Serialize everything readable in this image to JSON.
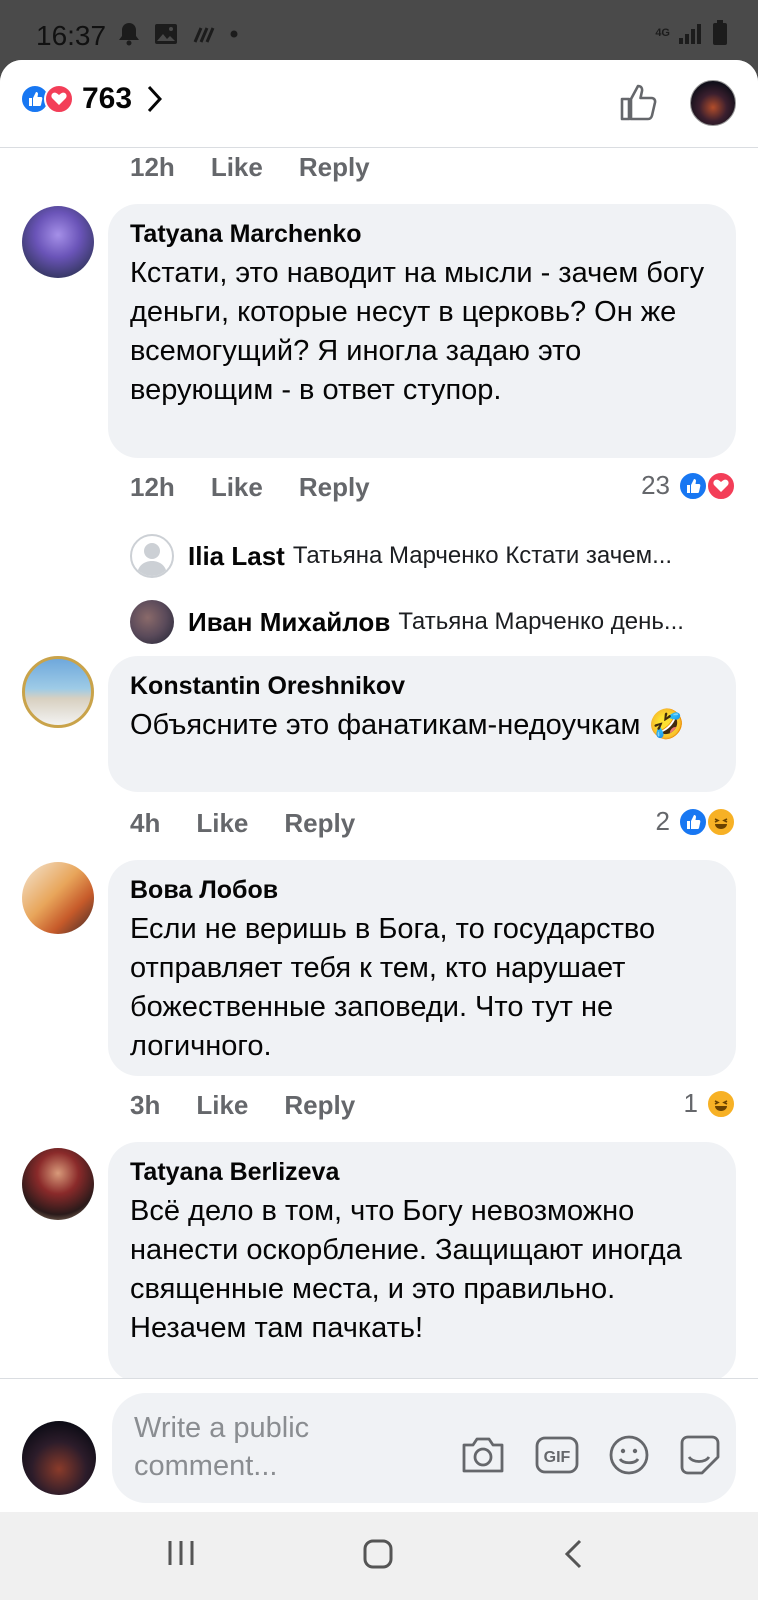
{
  "status_bar": {
    "time": "16:37",
    "left_icons": [
      "bell-icon",
      "image-icon",
      "nfc-icon",
      "dot-icon"
    ],
    "network": "4G",
    "right_icons": [
      "signal-icon",
      "battery-icon"
    ]
  },
  "header": {
    "reaction_icons": [
      "like-reaction-icon",
      "love-reaction-icon"
    ],
    "total_reactions": "763"
  },
  "prev_comment_meta": {
    "time": "12h",
    "like": "Like",
    "reply": "Reply"
  },
  "comments": [
    {
      "author": "Tatyana Marchenko",
      "text": "Кстати, это наводит на мысли - зачем богу деньги, которые несут в церковь? Он же всемогущий? Я иногла задаю это верующим - в ответ ступор.",
      "time": "12h",
      "like": "Like",
      "reply": "Reply",
      "reaction_count": "23",
      "reactions": [
        "like",
        "love"
      ],
      "replies": [
        {
          "name": "Ilia Last",
          "text": "Татьяна Марченко Кстати зачем..."
        },
        {
          "name": "Иван Михайлов",
          "text": "Татьяна Марченко день..."
        }
      ]
    },
    {
      "author": "Konstantin Oreshnikov",
      "text": "Объясните это фанатикам-недоучкам",
      "emoji": "🤣",
      "time": "4h",
      "like": "Like",
      "reply": "Reply",
      "reaction_count": "2",
      "reactions": [
        "like",
        "haha"
      ]
    },
    {
      "author": "Вова Лобов",
      "text": "Если не веришь в Бога, то государство отправляет тебя к тем, кто нарушает божественные заповеди. Что тут не логичного.",
      "time": "3h",
      "like": "Like",
      "reply": "Reply",
      "reaction_count": "1",
      "reactions": [
        "haha"
      ]
    },
    {
      "author": "Tatyana Berlizeva",
      "text": "Всё дело в том, что Богу невозможно нанести оскорбление. Защищают иногда священные места, и это правильно. Незачем там пачкать!"
    }
  ],
  "composer": {
    "placeholder": "Write a public comment...",
    "tools": [
      "camera-icon",
      "gif-icon",
      "emoji-icon",
      "sticker-icon"
    ],
    "gif_label": "GIF"
  },
  "nav": [
    "recents-button",
    "home-button",
    "back-button"
  ],
  "colors": {
    "like": "#1877f2",
    "love": "#f33e58",
    "haha": "#f7b125",
    "bubble": "#f0f2f5",
    "meta": "#65676b"
  }
}
